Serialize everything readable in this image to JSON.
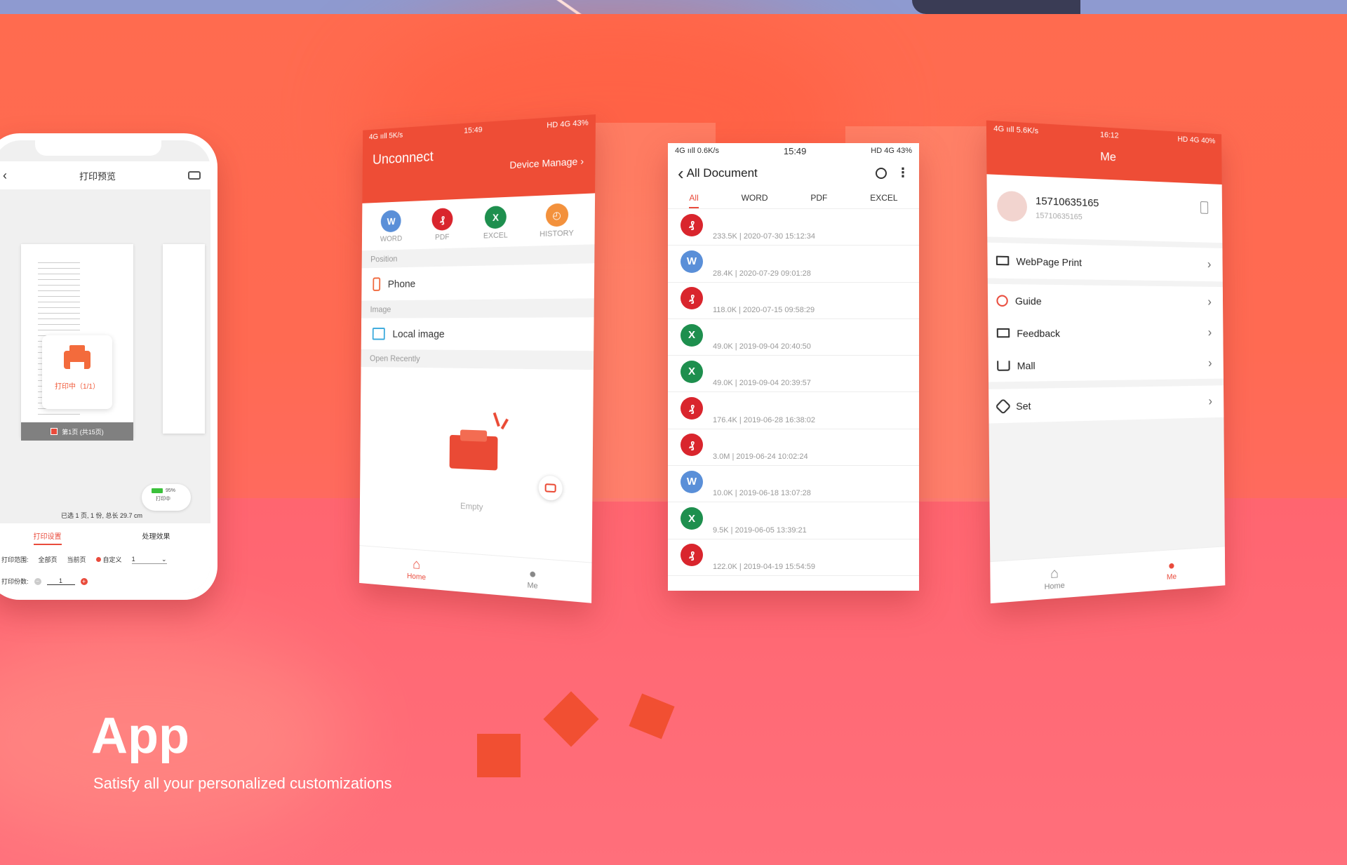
{
  "hero": {
    "title": "App",
    "subtitle": "Satisfy all your personalized customizations"
  },
  "colors": {
    "accent": "#ee4d36",
    "pdf": "#d9252d",
    "word": "#5a8fd8",
    "excel": "#1e8f4e",
    "history": "#f3913c"
  },
  "phone1": {
    "title": "打印预览",
    "printing_label": "打印中（1/1）",
    "page_label": "第1页 (共15页)",
    "summary": "已选 1 页, 1 份, 总长 29.7 cm",
    "tabs": [
      "打印设置",
      "处理效果"
    ],
    "range_label": "打印范围:",
    "range_options": [
      "全部页",
      "当前页",
      "自定义"
    ],
    "range_value": "1",
    "copies_label": "打印份数:",
    "copies_value": "1",
    "status_badge": "打印中",
    "battery_percent": "95%"
  },
  "phone2": {
    "status": {
      "network": "4G ııll  5K/s",
      "time": "15:49",
      "icons": "HD 4G 43%"
    },
    "title": "Unconnect",
    "device_link": "Device Manage",
    "quick": [
      {
        "label": "WORD",
        "icon": "word-icon",
        "glyph": "W"
      },
      {
        "label": "PDF",
        "icon": "pdf-icon",
        "glyph": "₰"
      },
      {
        "label": "EXCEL",
        "icon": "excel-icon",
        "glyph": "X"
      },
      {
        "label": "HISTORY",
        "icon": "history-icon",
        "glyph": "◴"
      }
    ],
    "position_header": "Position",
    "phone_item": "Phone",
    "image_header": "Image",
    "local_image_item": "Local image",
    "recent_header": "Open Recently",
    "empty_label": "Empty",
    "nav": {
      "home": "Home",
      "me": "Me"
    }
  },
  "phone3": {
    "status": {
      "network": "4G ııll  0.6K/s",
      "time": "15:49",
      "icons": "HD 4G 43%"
    },
    "title": "All Document",
    "tabs": [
      "All",
      "WORD",
      "PDF",
      "EXCEL"
    ],
    "active_tab": "All",
    "files": [
      {
        "type": "pdf",
        "meta": "233.5K | 2020-07-30 15:12:34"
      },
      {
        "type": "word",
        "meta": "28.4K | 2020-07-29 09:01:28"
      },
      {
        "type": "pdf",
        "meta": "118.0K | 2020-07-15 09:58:29"
      },
      {
        "type": "excel",
        "meta": "49.0K | 2019-09-04 20:40:50"
      },
      {
        "type": "excel",
        "meta": "49.0K | 2019-09-04 20:39:57"
      },
      {
        "type": "pdf",
        "meta": "176.4K | 2019-06-28 16:38:02"
      },
      {
        "type": "pdf",
        "meta": "3.0M | 2019-06-24 10:02:24"
      },
      {
        "type": "word",
        "meta": "10.0K | 2019-06-18 13:07:28"
      },
      {
        "type": "excel",
        "meta": "9.5K | 2019-06-05 13:39:21"
      },
      {
        "type": "pdf",
        "meta": "122.0K | 2019-04-19 15:54:59"
      }
    ]
  },
  "phone4": {
    "status": {
      "network": "4G ııll  5.6K/s",
      "time": "16:12",
      "icons": "HD 4G 40%"
    },
    "title": "Me",
    "user": {
      "name": "15710635165",
      "id": "15710635165"
    },
    "menu": [
      {
        "label": "WebPage Print",
        "icon": "monitor-icon"
      },
      {
        "label": "Guide",
        "icon": "help-icon"
      },
      {
        "label": "Feedback",
        "icon": "mail-icon"
      },
      {
        "label": "Mall",
        "icon": "cart-icon"
      },
      {
        "label": "Set",
        "icon": "settings-icon"
      }
    ],
    "nav": {
      "home": "Home",
      "me": "Me"
    }
  }
}
